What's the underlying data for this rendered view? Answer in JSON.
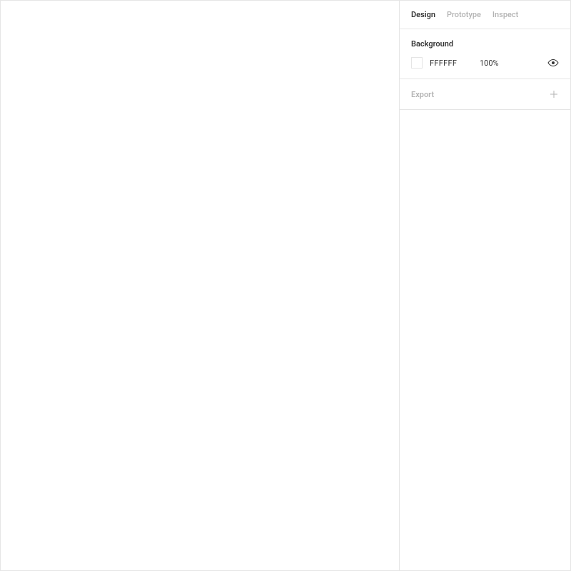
{
  "tabs": {
    "design": "Design",
    "prototype": "Prototype",
    "inspect": "Inspect"
  },
  "background": {
    "label": "Background",
    "hex": "FFFFFF",
    "opacity": "100%",
    "swatch_color": "#FFFFFF"
  },
  "export": {
    "label": "Export"
  }
}
